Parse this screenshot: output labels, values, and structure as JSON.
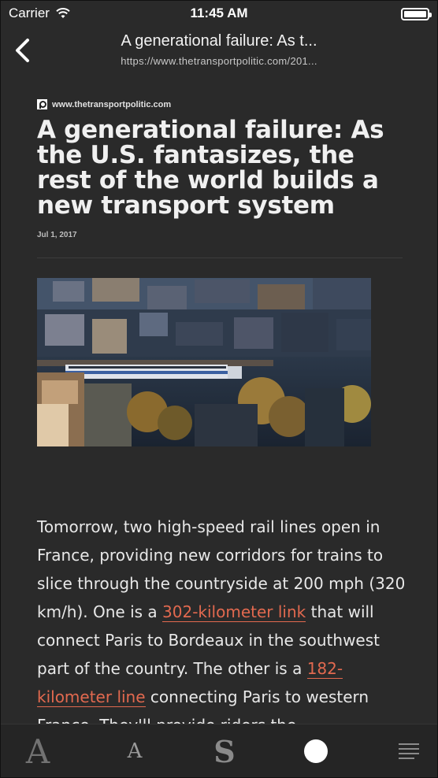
{
  "status_bar": {
    "carrier": "Carrier",
    "time": "11:45 AM",
    "battery_level": 1.0
  },
  "nav": {
    "title": "A generational failure: As t...",
    "url": "https://www.thetransportpolitic.com/201..."
  },
  "article": {
    "source": "www.thetransportpolitic.com",
    "headline": "A generational failure: As the U.S. fantasizes, the rest of the world builds a new transport system",
    "date": "Jul 1, 2017",
    "body": {
      "t1": "Tomorrow, two high-speed rail lines open in France, providing new corridors for trains to slice through the countryside at 200 mph (320 km/h). One is a ",
      "link1": "302-kilometer link",
      "t2": " that will connect Paris to Bordeaux in the southwest part of the country. The other is a ",
      "link2": "182-kilometer line",
      "t3": " connecting Paris to western France. They'll provide riders the"
    }
  },
  "toolbar": {
    "serif_font_label": "A",
    "sans_font_label": "A",
    "script_font_label": "S"
  },
  "colors": {
    "background": "#2a2a2a",
    "link": "#e2694f",
    "text": "#e8e8e8"
  }
}
